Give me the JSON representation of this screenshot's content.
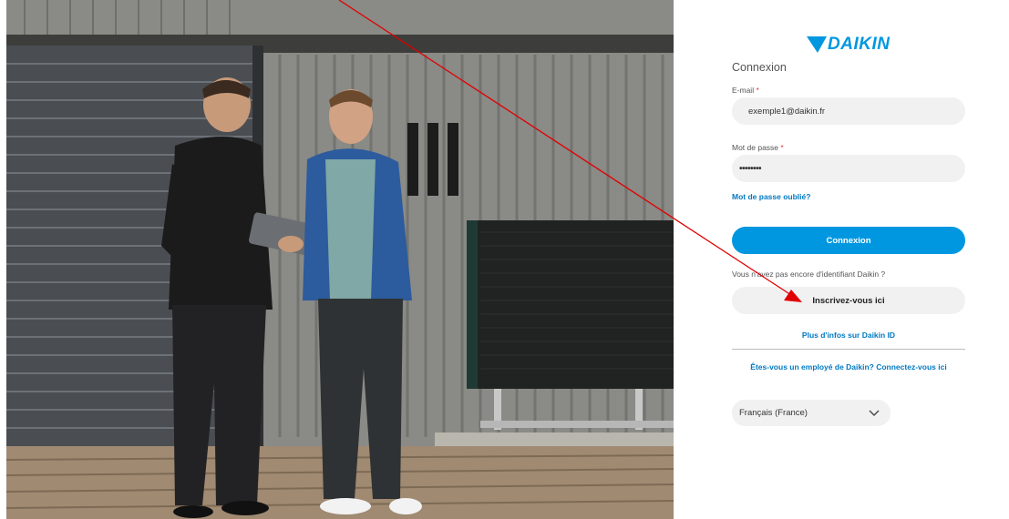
{
  "brand": {
    "name": "DAIKIN",
    "color": "#0097e0"
  },
  "login": {
    "title": "Connexion",
    "email": {
      "label": "E-mail",
      "required_mark": "*",
      "value": "exemple1@daikin.fr"
    },
    "password": {
      "label": "Mot de passe",
      "required_mark": "*",
      "value": "••••••••"
    },
    "forgot_label": "Mot de passe oublié?",
    "submit_label": "Connexion",
    "no_id_text": "Vous n'avez pas encore d'identifiant Daikin ?",
    "register_label": "Inscrivez-vous ici",
    "info_label": "Plus d'infos sur Daikin ID",
    "employee_label": "Êtes-vous un employé de Daikin? Connectez-vous ici"
  },
  "language": {
    "selected": "Français (France)"
  },
  "icons": {
    "logo": "daikin-logo-icon",
    "dropdown": "chevron-down-icon",
    "annotation": "red-arrow-annotation"
  },
  "colors": {
    "primary": "#0097e0",
    "link": "#0079c1",
    "required": "#e0393e",
    "field_bg": "#f1f1f1",
    "annotation": "#e00000"
  }
}
